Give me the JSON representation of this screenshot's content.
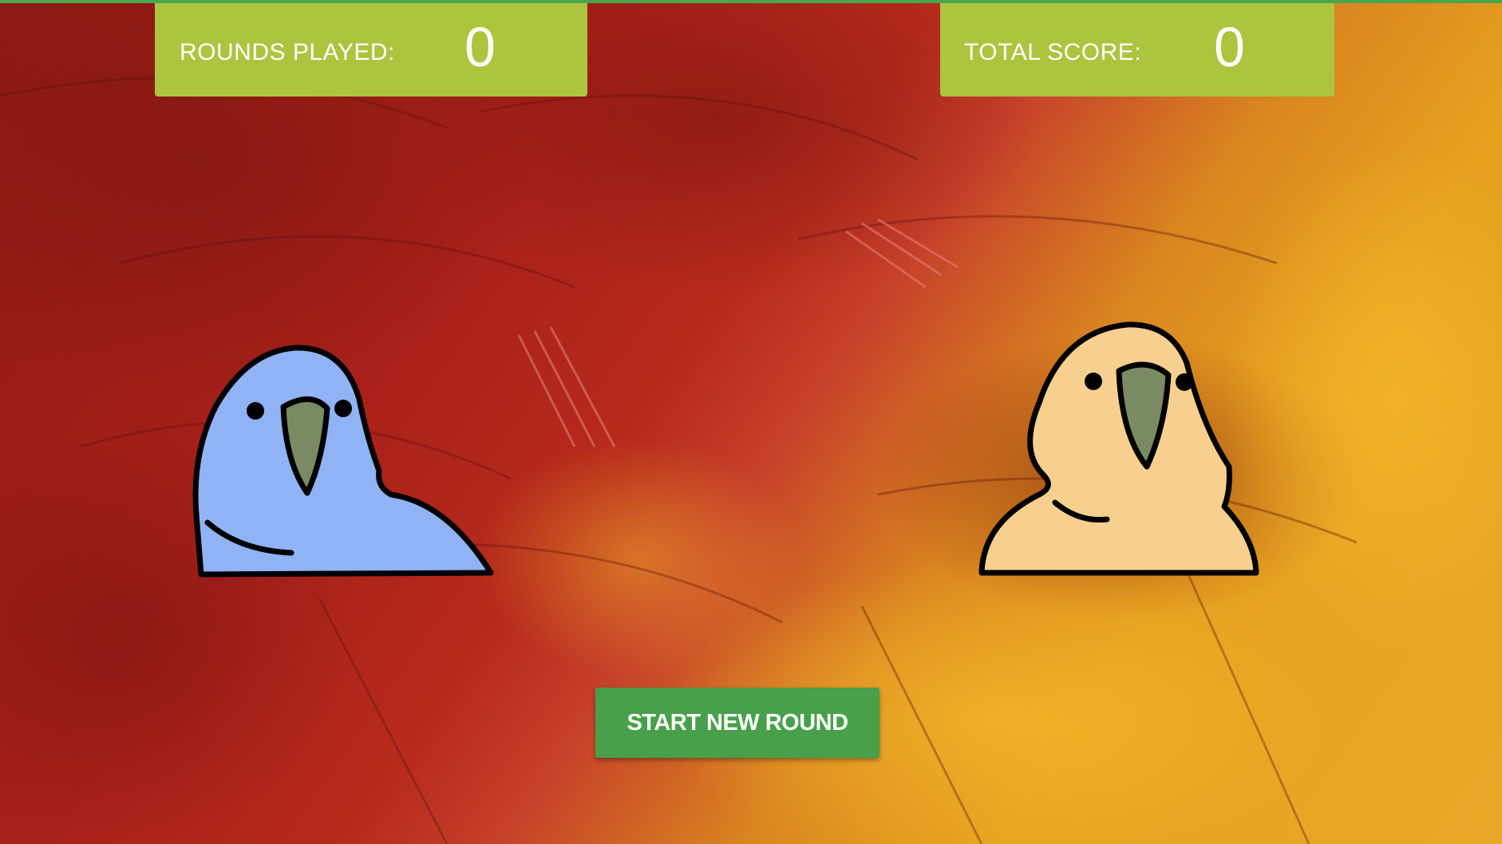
{
  "scoreboard": {
    "rounds_label": "ROUNDS PLAYED:",
    "rounds_value": "0",
    "score_label": "TOTAL SCORE:",
    "score_value": "0"
  },
  "parrots": [
    {
      "name": "blue-parrot",
      "color": "#8fb3f5",
      "beak_color": "#7a8a62"
    },
    {
      "name": "orange-parrot",
      "color": "#f7d08f",
      "beak_color": "#7a8a62"
    }
  ],
  "actions": {
    "start_label": "START NEW ROUND"
  },
  "colors": {
    "panel": "#adc43f",
    "button": "#48a04b",
    "accent_strip": "#4aa64d",
    "background_red": "#a8201a",
    "background_yellow": "#e6a21f"
  }
}
